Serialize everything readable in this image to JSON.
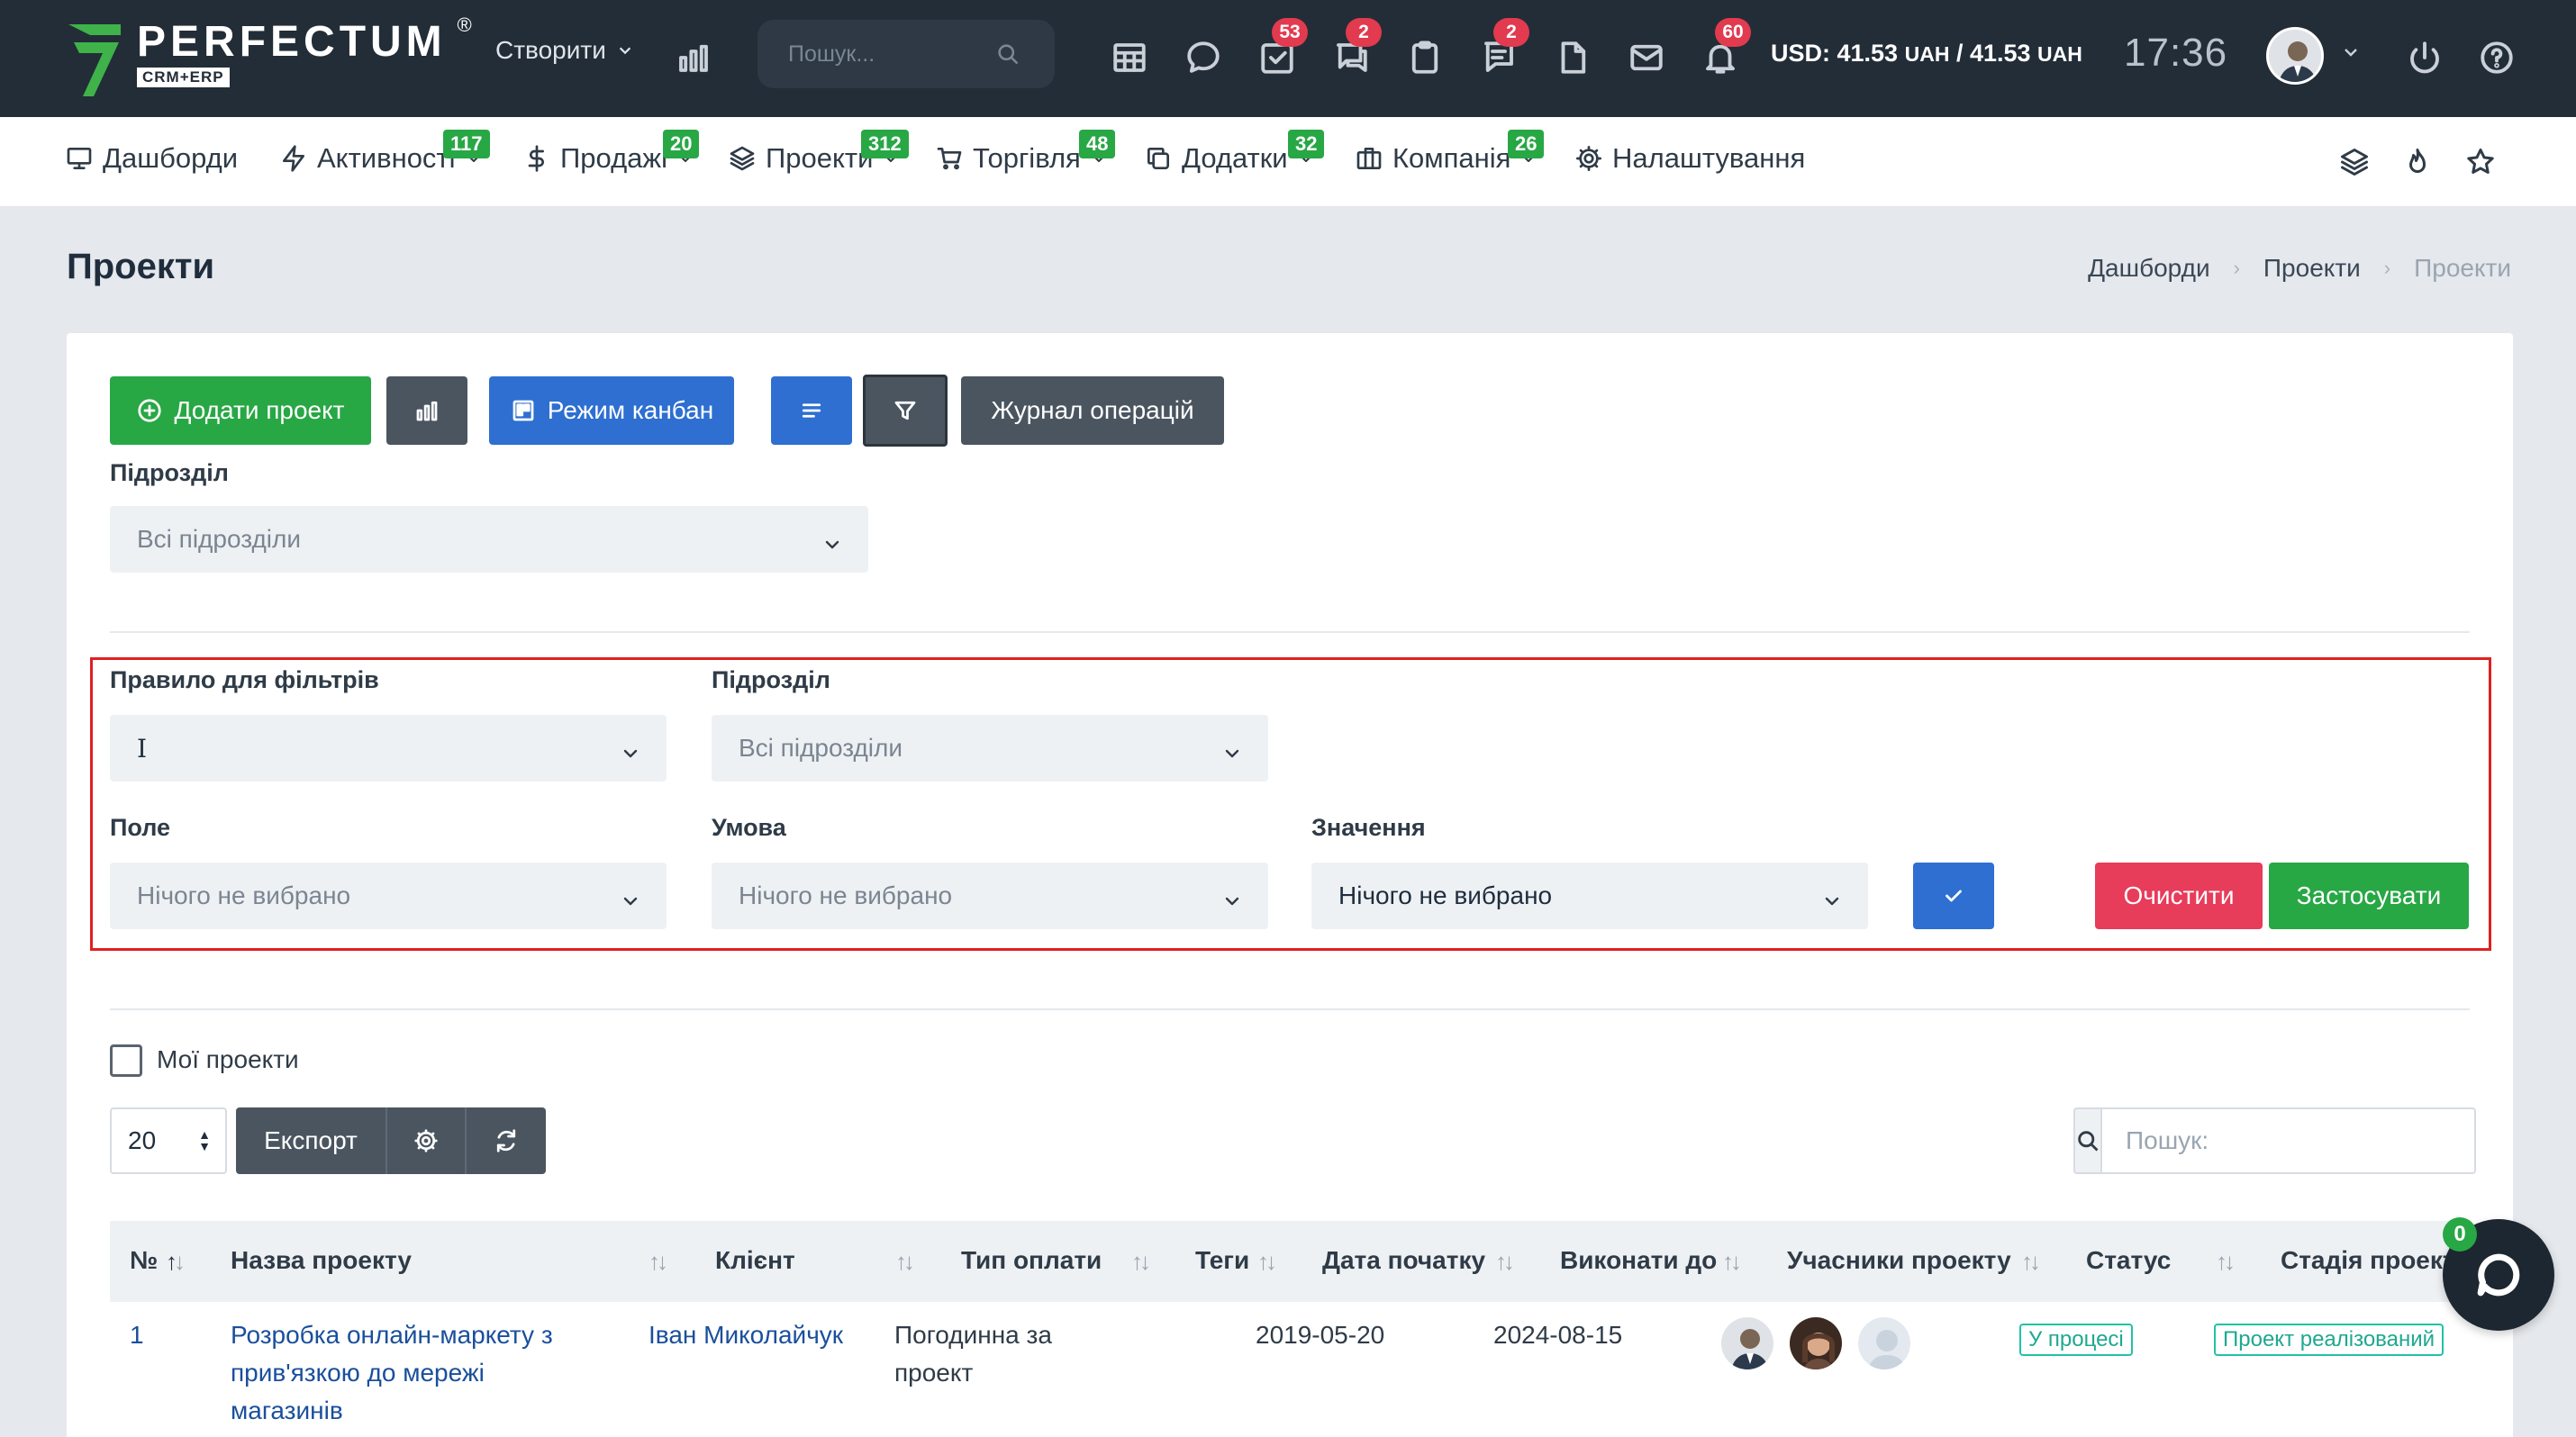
{
  "topbar": {
    "logo_text": "PERFECTUM",
    "logo_sub": "CRM+ERP",
    "logo_reg": "®",
    "create_label": "Створити",
    "search_placeholder": "Пошук...",
    "badges": {
      "tasks": "53",
      "chat": "2",
      "comments": "2",
      "notifications": "60"
    },
    "currency_prefix": "USD: 41.53",
    "currency_unit1": "UAH",
    "currency_mid": " / 41.53 ",
    "currency_unit2": "UAH",
    "time": "17:36"
  },
  "menu": {
    "items": [
      {
        "label": "Дашборди",
        "icon": "monitor-icon"
      },
      {
        "label": "Активності",
        "badge": "117",
        "icon": "lightning-icon"
      },
      {
        "label": "Продажі",
        "badge": "20",
        "icon": "dollar-icon"
      },
      {
        "label": "Проекти",
        "badge": "312",
        "icon": "layers-icon"
      },
      {
        "label": "Торгівля",
        "badge": "48",
        "icon": "cart-icon"
      },
      {
        "label": "Додатки",
        "badge": "32",
        "icon": "copy-icon"
      },
      {
        "label": "Компанія",
        "badge": "26",
        "icon": "briefcase-icon"
      },
      {
        "label": "Налаштування",
        "icon": "gear-icon"
      }
    ]
  },
  "page": {
    "title": "Проекти",
    "breadcrumb": [
      "Дашборди",
      "Проекти",
      "Проекти"
    ]
  },
  "toolbar": {
    "add_project": "Додати проект",
    "kanban": "Режим канбан",
    "journal": "Журнал операцій"
  },
  "division": {
    "label": "Підрозділ",
    "value": "Всі підрозділи"
  },
  "filters": {
    "rule_label": "Правило для фільтрів",
    "rule_value": "I",
    "division_label": "Підрозділ",
    "division_value": "Всі підрозділи",
    "field_label": "Поле",
    "field_value": "Нічого не вибрано",
    "condition_label": "Умова",
    "condition_value": "Нічого не вибрано",
    "value_label": "Значення",
    "value_value": "Нічого не вибрано",
    "clear": "Очистити",
    "apply": "Застосувати"
  },
  "list": {
    "my_projects": "Мої проекти",
    "page_size": "20",
    "export": "Експорт",
    "search_placeholder": "Пошук:"
  },
  "table": {
    "columns": [
      "№",
      "Назва проекту",
      "Клієнт",
      "Тип оплати",
      "Теги",
      "Дата початку",
      "Виконати до",
      "Учасники проекту",
      "Статус",
      "Стадія проекту"
    ],
    "rows": [
      {
        "num": "1",
        "name_lines": [
          "Розробка онлайн-маркету з",
          "прив'язкою до мережі",
          "магазинів"
        ],
        "client": "Іван Миколайчук",
        "payment_lines": [
          "Погодинна за",
          "проект"
        ],
        "start": "2019-05-20",
        "due": "2024-08-15",
        "status": "У процесі",
        "stage": "Проект реалізований"
      }
    ]
  },
  "chat": {
    "badge": "0"
  },
  "colors": {
    "topbar": "#232d37",
    "green": "#28a745",
    "blue": "#2e6fd1",
    "red": "#e73c5a",
    "dark_button": "#4a5560",
    "highlight_border": "#e02020"
  }
}
